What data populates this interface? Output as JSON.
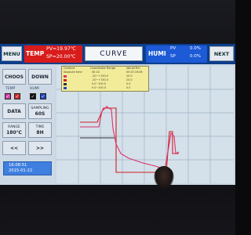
{
  "header": {
    "menu_label": "MENU",
    "temp_label": "TEMP",
    "temp_pv": "PV=19.97℃",
    "temp_sp": "SP=20.00℃",
    "curve_label": "CURVE",
    "humi_label": "HUMI",
    "humi_pv_label": "PV",
    "humi_sp_label": "SP",
    "humi_pv_value": "0.0%",
    "humi_sp_value": "0.0%",
    "next_label": "NEXT"
  },
  "sidebar": {
    "choose_label": "CHOOS",
    "down_label": "DOWN",
    "temp_label": "TEMP",
    "humi_label": "HUMI",
    "data_label": "DATA",
    "sampling_label": "SAMPLING",
    "sampling_value": "60S",
    "range_label": "RANGE",
    "range_value": "180℃",
    "time_label": "TIME",
    "time_value": "8H",
    "prev_label": "<<",
    "next_label": ">>"
  },
  "clock": {
    "time": "16:08:51",
    "date": "2015-01-22"
  },
  "legend": {
    "headers": [
      "Content",
      "Coordinate Range",
      "Value/Tim"
    ],
    "rows": [
      {
        "name": "Absolute time",
        "range": "00:14",
        "value": "05.03 16:06"
      },
      {
        "name": "",
        "range": "-20~+150.0",
        "value": "20.0"
      },
      {
        "name": "",
        "range": "-20~+150.0",
        "value": "20.0"
      },
      {
        "name": "",
        "range": "0.0~100.0",
        "value": "0.0"
      },
      {
        "name": "",
        "range": "0.0~100.0",
        "value": "0.0"
      },
      {
        "name": "",
        "range": "0.0~100.0",
        "value": "0.0"
      }
    ]
  },
  "colors": {
    "temp_pv": "#e0306a",
    "temp_sp": "#cc2020",
    "humi": "#333333",
    "grid": "#9fb3c6"
  }
}
